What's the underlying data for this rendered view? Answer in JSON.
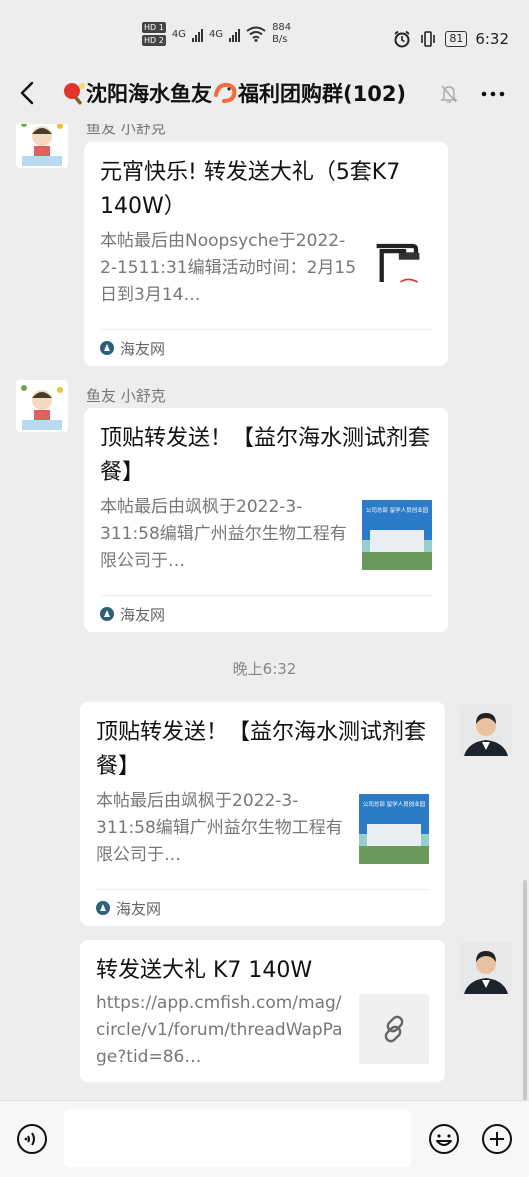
{
  "status_bar": {
    "speed_value": "884",
    "speed_unit": "B/s",
    "battery": "81",
    "time": "6:32",
    "hd1": "HD 1",
    "hd2": "HD 2",
    "net1": "4G",
    "net2": "4G"
  },
  "nav": {
    "title": "沈阳海水鱼友",
    "title_suffix": " 福利团购群(102)"
  },
  "messages": [
    {
      "sender": "鱼友 小舒克",
      "title": "元宵快乐! 转发送大礼（5套K7 140W）",
      "desc": "本帖最后由Noopsyche于2022-2-1511:31编辑活动时间：2月15日到3月14…",
      "source": "海友网"
    },
    {
      "sender": "鱼友 小舒克",
      "title": "顶贴转发送！【益尔海水测试剂套餐】",
      "desc": "本帖最后由飒枫于2022-3-311:58编辑广州益尔生物工程有限公司于…",
      "source": "海友网"
    },
    {
      "title": "顶贴转发送！【益尔海水测试剂套餐】",
      "desc": "本帖最后由飒枫于2022-3-311:58编辑广州益尔生物工程有限公司于…",
      "source": "海友网"
    },
    {
      "title": "转发送大礼 K7 140W",
      "desc": "https://app.cmfish.com/mag/circle/v1/forum/threadWapPage?tid=86…"
    }
  ],
  "time_separator": "晚上6:32",
  "thumb_caption": "公司总部 留学人员创业园",
  "colors": {
    "background": "#ededed",
    "card": "#ffffff",
    "secondary_text": "#777777"
  },
  "icons": [
    "back-icon",
    "mute-icon",
    "more-icon",
    "voice-icon",
    "emoji-icon",
    "plus-icon",
    "link-icon",
    "source-icon"
  ]
}
